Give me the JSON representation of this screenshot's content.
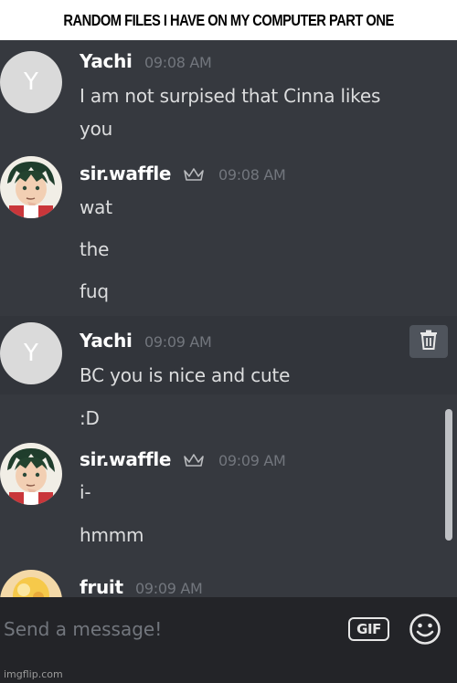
{
  "banner": {
    "title": "RANDOM FILES I HAVE ON MY COMPUTER PART ONE"
  },
  "messages": [
    {
      "author": "Yachi",
      "avatar_letter": "Y",
      "time": "09:08 AM",
      "lines": [
        "I am not surpised that Cinna likes",
        "you"
      ]
    },
    {
      "author": "sir.waffle",
      "crown": true,
      "time": "09:08 AM",
      "lines": [
        "wat",
        "the",
        "fuq"
      ]
    },
    {
      "author": "Yachi",
      "avatar_letter": "Y",
      "time": "09:09 AM",
      "lines": [
        "BC you is nice and cute",
        ":D"
      ]
    },
    {
      "author": "sir.waffle",
      "crown": true,
      "time": "09:09 AM",
      "lines": [
        "i-",
        "hmmm"
      ]
    },
    {
      "author": "fruit",
      "time": "09:09 AM",
      "lines": []
    }
  ],
  "composer": {
    "placeholder": "Send a message!",
    "gif_label": "GIF"
  },
  "icons": [
    "crown-icon",
    "trash-icon",
    "emoji-icon"
  ],
  "colors": {
    "background": "#36393f",
    "hover_row": "#32353b",
    "composer": "#232428",
    "username": "#ffffff",
    "timestamp": "#72767d"
  },
  "watermark": "imgflip.com"
}
